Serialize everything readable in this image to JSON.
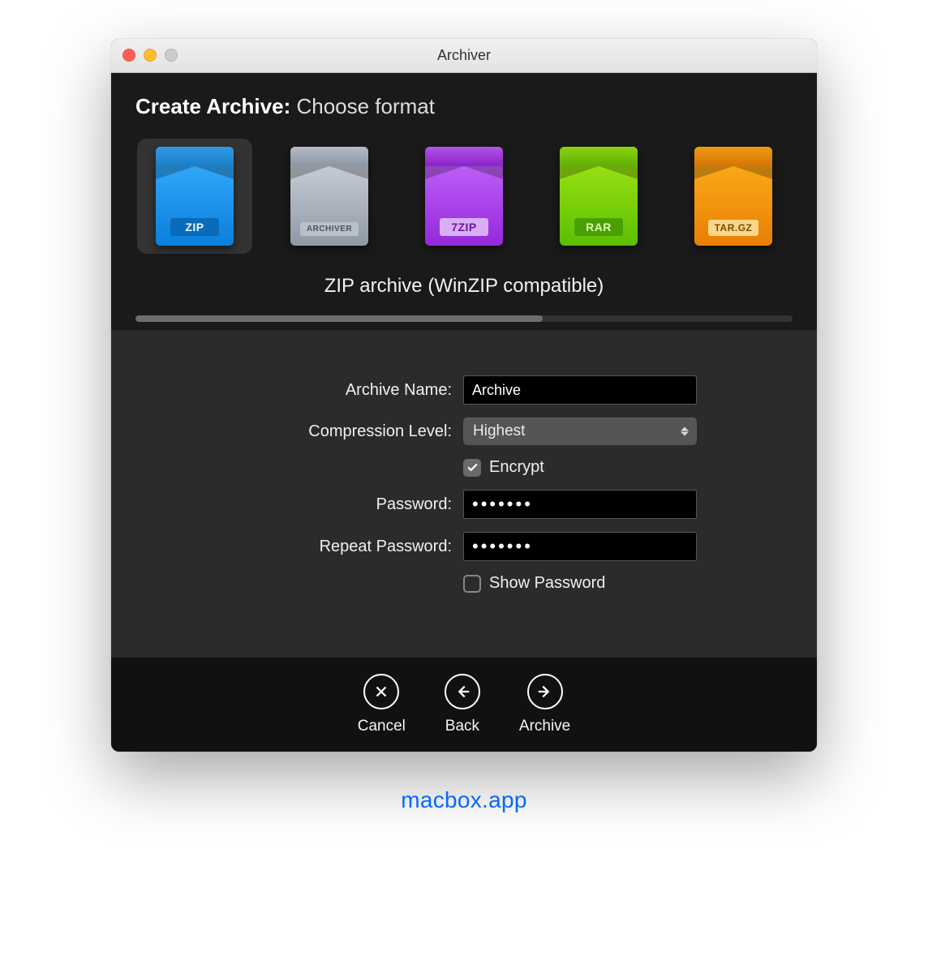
{
  "window": {
    "title": "Archiver"
  },
  "heading": {
    "bold": "Create Archive:",
    "thin": "Choose format"
  },
  "formats": [
    {
      "id": "zip",
      "label": "ZIP",
      "selected": true
    },
    {
      "id": "arch",
      "label": "ARCHIVER",
      "selected": false
    },
    {
      "id": "7zip",
      "label": "7ZIP",
      "selected": false
    },
    {
      "id": "rar",
      "label": "RAR",
      "selected": false
    },
    {
      "id": "targz",
      "label": "TAR.GZ",
      "selected": false
    }
  ],
  "selected_description": "ZIP archive (WinZIP compatible)",
  "progress_percent": 62,
  "form": {
    "archive_name_label": "Archive Name:",
    "archive_name_value": "Archive",
    "compression_label": "Compression Level:",
    "compression_value": "Highest",
    "encrypt_label": "Encrypt",
    "encrypt_checked": true,
    "password_label": "Password:",
    "password_value": "•••••••",
    "repeat_password_label": "Repeat Password:",
    "repeat_password_value": "•••••••",
    "show_password_label": "Show Password",
    "show_password_checked": false
  },
  "bottom": {
    "cancel": "Cancel",
    "back": "Back",
    "archive": "Archive"
  },
  "watermark": "macbox.app"
}
